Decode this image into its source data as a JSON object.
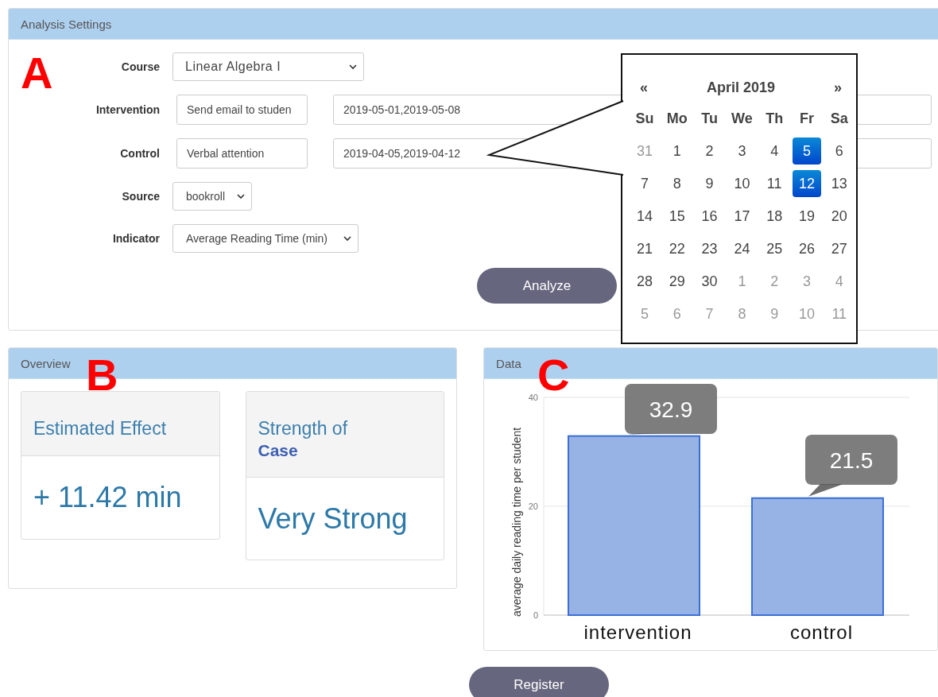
{
  "settings": {
    "title": "Analysis Settings",
    "badge": "A",
    "fields": [
      {
        "label": "Course",
        "kind": "select",
        "value": "Linear Algebra I"
      },
      {
        "label": "Intervention",
        "kind": "pair",
        "value": "Send email to studen",
        "dates": "2019-05-01,2019-05-08"
      },
      {
        "label": "Control",
        "kind": "pair",
        "value": "Verbal attention",
        "dates": "2019-04-05,2019-04-12"
      },
      {
        "label": "Source",
        "kind": "select",
        "value": "bookroll"
      },
      {
        "label": "Indicator",
        "kind": "select",
        "value": "Average Reading Time (min)"
      }
    ],
    "button": "Analyze"
  },
  "datepicker": {
    "prev": "«",
    "month": "April 2019",
    "next": "»",
    "weekdays": [
      "Su",
      "Mo",
      "Tu",
      "We",
      "Th",
      "Fr",
      "Sa"
    ],
    "days": [
      {
        "text": "31",
        "other_month": true,
        "selected": false
      },
      {
        "text": "1",
        "other_month": false,
        "selected": false
      },
      {
        "text": "2",
        "other_month": false,
        "selected": false
      },
      {
        "text": "3",
        "other_month": false,
        "selected": false
      },
      {
        "text": "4",
        "other_month": false,
        "selected": false
      },
      {
        "text": "5",
        "other_month": false,
        "selected": true
      },
      {
        "text": "6",
        "other_month": false,
        "selected": false
      },
      {
        "text": "7",
        "other_month": false,
        "selected": false
      },
      {
        "text": "8",
        "other_month": false,
        "selected": false
      },
      {
        "text": "9",
        "other_month": false,
        "selected": false
      },
      {
        "text": "10",
        "other_month": false,
        "selected": false
      },
      {
        "text": "11",
        "other_month": false,
        "selected": false
      },
      {
        "text": "12",
        "other_month": false,
        "selected": true
      },
      {
        "text": "13",
        "other_month": false,
        "selected": false
      },
      {
        "text": "14",
        "other_month": false,
        "selected": false
      },
      {
        "text": "15",
        "other_month": false,
        "selected": false
      },
      {
        "text": "16",
        "other_month": false,
        "selected": false
      },
      {
        "text": "17",
        "other_month": false,
        "selected": false
      },
      {
        "text": "18",
        "other_month": false,
        "selected": false
      },
      {
        "text": "19",
        "other_month": false,
        "selected": false
      },
      {
        "text": "20",
        "other_month": false,
        "selected": false
      },
      {
        "text": "21",
        "other_month": false,
        "selected": false
      },
      {
        "text": "22",
        "other_month": false,
        "selected": false
      },
      {
        "text": "23",
        "other_month": false,
        "selected": false
      },
      {
        "text": "24",
        "other_month": false,
        "selected": false
      },
      {
        "text": "25",
        "other_month": false,
        "selected": false
      },
      {
        "text": "26",
        "other_month": false,
        "selected": false
      },
      {
        "text": "27",
        "other_month": false,
        "selected": false
      },
      {
        "text": "28",
        "other_month": false,
        "selected": false
      },
      {
        "text": "29",
        "other_month": false,
        "selected": false
      },
      {
        "text": "30",
        "other_month": false,
        "selected": false
      },
      {
        "text": "1",
        "other_month": true,
        "selected": false
      },
      {
        "text": "2",
        "other_month": true,
        "selected": false
      },
      {
        "text": "3",
        "other_month": true,
        "selected": false
      },
      {
        "text": "4",
        "other_month": true,
        "selected": false
      },
      {
        "text": "5",
        "other_month": true,
        "selected": false
      },
      {
        "text": "6",
        "other_month": true,
        "selected": false
      },
      {
        "text": "7",
        "other_month": true,
        "selected": false
      },
      {
        "text": "8",
        "other_month": true,
        "selected": false
      },
      {
        "text": "9",
        "other_month": true,
        "selected": false
      },
      {
        "text": "10",
        "other_month": true,
        "selected": false
      },
      {
        "text": "11",
        "other_month": true,
        "selected": false
      }
    ]
  },
  "overview": {
    "title": "Overview",
    "badge": "B",
    "cards": [
      {
        "title": "Estimated Effect",
        "value": "+ 11.42 min"
      },
      {
        "title": "Strength of **Case**",
        "value": "Very Strong"
      }
    ]
  },
  "data": {
    "title": "Data",
    "badge": "C",
    "chart_data": {
      "type": "bar",
      "ylabel": "average daily reading time per student",
      "categories": [
        "intervention",
        "control"
      ],
      "values": [
        32.9,
        21.5
      ],
      "ylim": [
        0,
        40
      ],
      "yticks": [
        0,
        20,
        40
      ],
      "data_labels": true
    }
  },
  "register_button": "Register"
}
